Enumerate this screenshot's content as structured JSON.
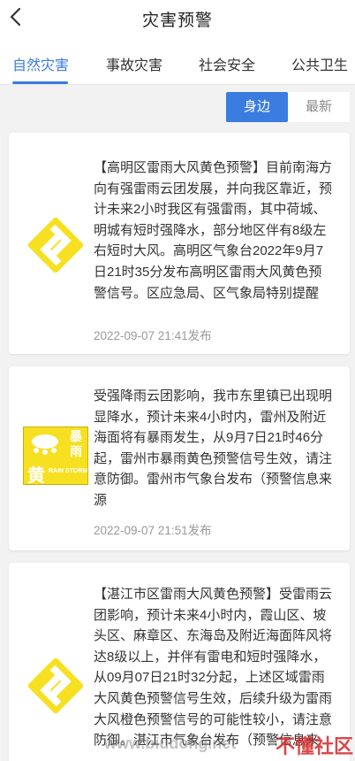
{
  "header": {
    "title": "灾害预警"
  },
  "tabs": [
    "自然灾害",
    "事故灾害",
    "社会安全",
    "公共卫生"
  ],
  "filters": {
    "nearby": "身边",
    "latest": "最新"
  },
  "colors": {
    "accent": "#3a7ce0",
    "warning_yellow": "#f7e021"
  },
  "cards": [
    {
      "icon": "yellow-thunderstorm-wind-warning-icon",
      "text": "【高明区雷雨大风黄色预警】目前南海方向有强雷雨云团发展，并向我区靠近，预计未来2小时我区有强雷雨，其中荷城、明城有短时强降水，部分地区伴有8级左右短时大风。高明区气象台2022年9月7日21时35分发布高明区雷雨大风黄色预警信号。区应急局、区气象局特别提醒",
      "time": "2022-09-07 21:41发布"
    },
    {
      "icon": "yellow-rainstorm-warning-icon",
      "icon_chars": [
        "暴",
        "雨",
        "黄"
      ],
      "icon_caption": "RAIN STORM",
      "text": "受强降雨云团影响，我市东里镇已出现明显降水，预计未来4小时内，雷州及附近海面将有暴雨发生，从9月7日21时46分起，雷州市暴雨黄色预警信号生效，请注意防御。雷州市气象台发布（预警信息来源",
      "time": "2022-09-07 21:51发布"
    },
    {
      "icon": "yellow-thunderstorm-wind-warning-icon",
      "text": "【湛江市区雷雨大风黄色预警】受雷雨云团影响，预计未来4小时内，霞山区、坡头区、麻章区、东海岛及附近海面阵风将达8级以上，并伴有雷电和短时强降水，从09月07日21时32分起，上述区域雷雨大风黄色预警信号生效，后续升级为雷雨大风橙色预警信号的可能性较小，请注意防御。湛江市气象台发布（预警信息来"
    }
  ],
  "watermark": {
    "site": "www.biudong.net",
    "brand": "不懂社区"
  }
}
